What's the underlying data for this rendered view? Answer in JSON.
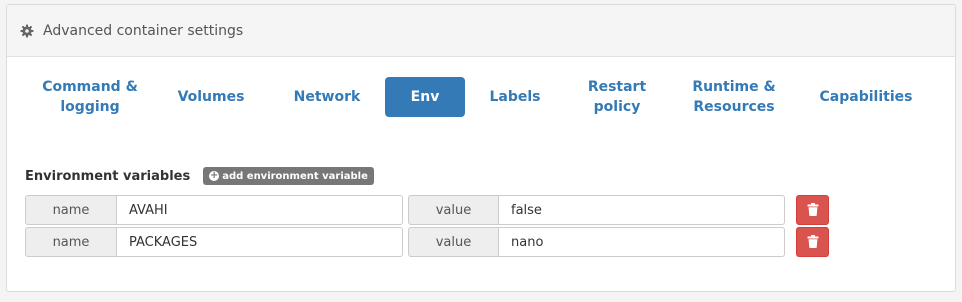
{
  "panel": {
    "title": "Advanced container settings",
    "icon": "gear-icon"
  },
  "tabs": [
    {
      "label": "Command &\nlogging",
      "active": false
    },
    {
      "label": "Volumes",
      "active": false
    },
    {
      "label": "Network",
      "active": false
    },
    {
      "label": "Env",
      "active": true
    },
    {
      "label": "Labels",
      "active": false
    },
    {
      "label": "Restart\npolicy",
      "active": false
    },
    {
      "label": "Runtime &\nResources",
      "active": false
    },
    {
      "label": "Capabilities",
      "active": false
    }
  ],
  "env": {
    "section_label": "Environment variables",
    "add_button_label": "add environment variable",
    "name_addon": "name",
    "value_addon": "value",
    "rows": [
      {
        "name": "AVAHI",
        "value": "false"
      },
      {
        "name": "PACKAGES",
        "value": "nano"
      }
    ]
  },
  "colors": {
    "accent": "#337ab7",
    "danger": "#d9534f",
    "muted_button": "#777777"
  }
}
